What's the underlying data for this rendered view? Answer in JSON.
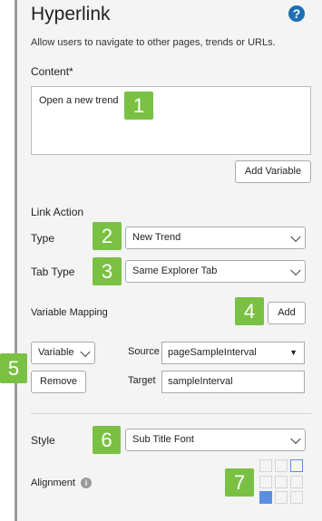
{
  "header": {
    "title": "Hyperlink",
    "help_icon": "?",
    "description": "Allow users to navigate to other pages, trends or URLs."
  },
  "content": {
    "label": "Content*",
    "value": "Open a new trend",
    "add_variable_label": "Add Variable"
  },
  "link_action": {
    "heading": "Link Action",
    "type_label": "Type",
    "type_value": "New Trend",
    "tab_type_label": "Tab Type",
    "tab_type_value": "Same Explorer Tab",
    "variable_mapping_label": "Variable Mapping",
    "add_label": "Add",
    "mapping": {
      "kind_value": "Variable",
      "remove_label": "Remove",
      "source_label": "Source",
      "source_value": "pageSampleInterval",
      "target_label": "Target",
      "target_value": "sampleInterval"
    }
  },
  "style": {
    "label": "Style",
    "value": "Sub Title Font",
    "alignment_label": "Alignment",
    "alignment_info_icon": "i",
    "alignment_selected": "bottom-left"
  },
  "callouts": [
    "1",
    "2",
    "3",
    "4",
    "5",
    "6",
    "7"
  ],
  "colors": {
    "callout": "#7ac143",
    "help": "#1c6fb5",
    "alignment_selected": "#5b8ee0"
  }
}
